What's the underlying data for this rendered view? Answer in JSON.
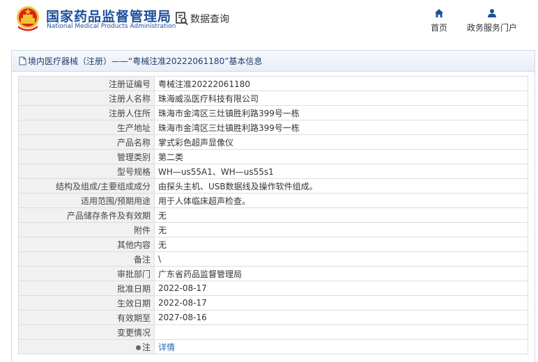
{
  "header": {
    "brand_cn": "国家药品监督管理局",
    "brand_en": "National Medical Products Administration",
    "query_label": "数据查询",
    "nav": {
      "home": "首页",
      "service": "政务服务门户"
    }
  },
  "colors": {
    "brand": "#1d4f9c",
    "link": "#2a63b6",
    "emblem_red": "#d8231c",
    "emblem_gold": "#f2c230"
  },
  "panel": {
    "title": "境内医疗器械（注册）——“粤械注准20222061180”基本信息"
  },
  "rows": [
    {
      "label": "注册证编号",
      "value": "粤械注准20222061180"
    },
    {
      "label": "注册人名称",
      "value": "珠海威泓医疗科技有限公司"
    },
    {
      "label": "注册人住所",
      "value": "珠海市金湾区三灶镇胜利路399号一栋"
    },
    {
      "label": "生产地址",
      "value": "珠海市金湾区三灶镇胜利路399号一栋"
    },
    {
      "label": "产品名称",
      "value": "掌式彩色超声显像仪"
    },
    {
      "label": "管理类别",
      "value": "第二类"
    },
    {
      "label": "型号规格",
      "value": "WH—us55A1、WH—us55s1"
    },
    {
      "label": "结构及组成/主要组成成分",
      "value": "由探头主机、USB数据线及操作软件组成。"
    },
    {
      "label": "适用范围/预期用途",
      "value": "用于人体临床超声检查。"
    },
    {
      "label": "产品储存条件及有效期",
      "value": "无"
    },
    {
      "label": "附件",
      "value": "无"
    },
    {
      "label": "其他内容",
      "value": "无"
    },
    {
      "label": "备注",
      "value": "\\"
    },
    {
      "label": "审批部门",
      "value": "广东省药品监督管理局"
    },
    {
      "label": "批准日期",
      "value": "2022-08-17"
    },
    {
      "label": "生效日期",
      "value": "2022-08-17"
    },
    {
      "label": "有效期至",
      "value": "2027-08-16"
    },
    {
      "label": "变更情况",
      "value": ""
    }
  ],
  "note_row": {
    "label": "注",
    "link": "详情"
  },
  "icons": {
    "emblem": "national-emblem-icon",
    "query": "document-search-icon",
    "home": "home-icon",
    "service": "user-icon",
    "title": "document-icon",
    "note": "dot-icon"
  }
}
